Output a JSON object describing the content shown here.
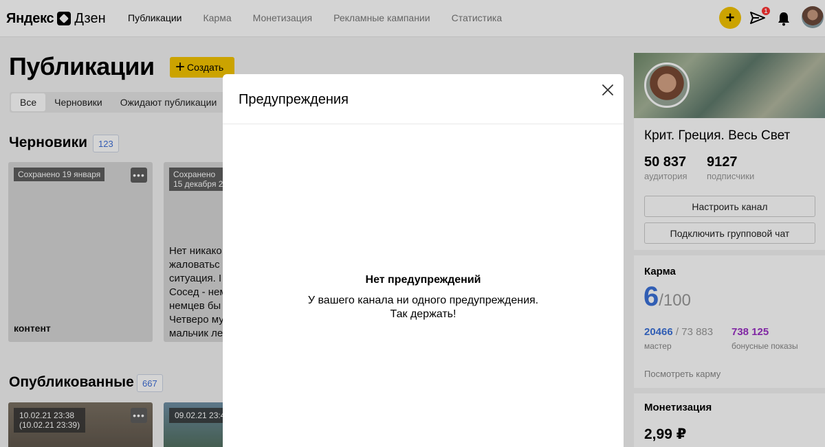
{
  "header": {
    "logo_left": "Яндекс",
    "logo_right": "Дзен",
    "nav": [
      {
        "label": "Публикации",
        "active": true
      },
      {
        "label": "Карма",
        "active": false
      },
      {
        "label": "Монетизация",
        "active": false
      },
      {
        "label": "Рекламные кампании",
        "active": false
      },
      {
        "label": "Статистика",
        "active": false
      }
    ],
    "add_icon": "plus-icon",
    "messages_icon": "send-icon",
    "messages_badge": "1",
    "notifications_icon": "bell-icon",
    "accent_color": "#f5c400"
  },
  "page": {
    "title": "Публикации",
    "create_label": "Создать",
    "filters": [
      "Все",
      "Черновики",
      "Ожидают публикации"
    ]
  },
  "drafts": {
    "title": "Черновики",
    "count": "123",
    "cards": [
      {
        "tag": "Сохранено 19 января",
        "text": "контент"
      },
      {
        "tag_line1": "Сохранено",
        "tag_line2": "15 декабря 20",
        "text_lines": [
          "Нет никако",
          "жаловатьс",
          "ситуация. I",
          "Сосед - нем",
          "немцев бы",
          "Четверо му",
          "мальчик ле"
        ]
      }
    ]
  },
  "published": {
    "title": "Опубликованные",
    "count": "667",
    "cards": [
      {
        "tag_line1": "10.02.21 23:38",
        "tag_line2": "(10.02.21 23:39)"
      },
      {
        "tag_line1": "09.02.21 23:4"
      }
    ]
  },
  "sidebar": {
    "channel_name": "Крит. Греция. Весь Свет",
    "audience_value": "50 837",
    "audience_label": "аудитория",
    "subscribers_value": "9127",
    "subscribers_label": "подписчики",
    "setup_button": "Настроить канал",
    "chat_button": "Подключить групповой чат",
    "karma_title": "Карма",
    "karma_value": "6",
    "karma_max": "/100",
    "master_value": "20466",
    "master_total": " / 73 883",
    "master_label": "мастер",
    "bonus_value": "738 125",
    "bonus_label": "бонусные показы",
    "karma_link": "Посмотреть карму",
    "monetization_title": "Монетизация",
    "monetization_value": "2,99 ₽"
  },
  "modal": {
    "title": "Предупреждения",
    "close_icon": "close-icon",
    "empty_title": "Нет предупреждений",
    "empty_text_line1": "У вашего канала ни одного предупреждения.",
    "empty_text_line2": "Так держать!"
  }
}
